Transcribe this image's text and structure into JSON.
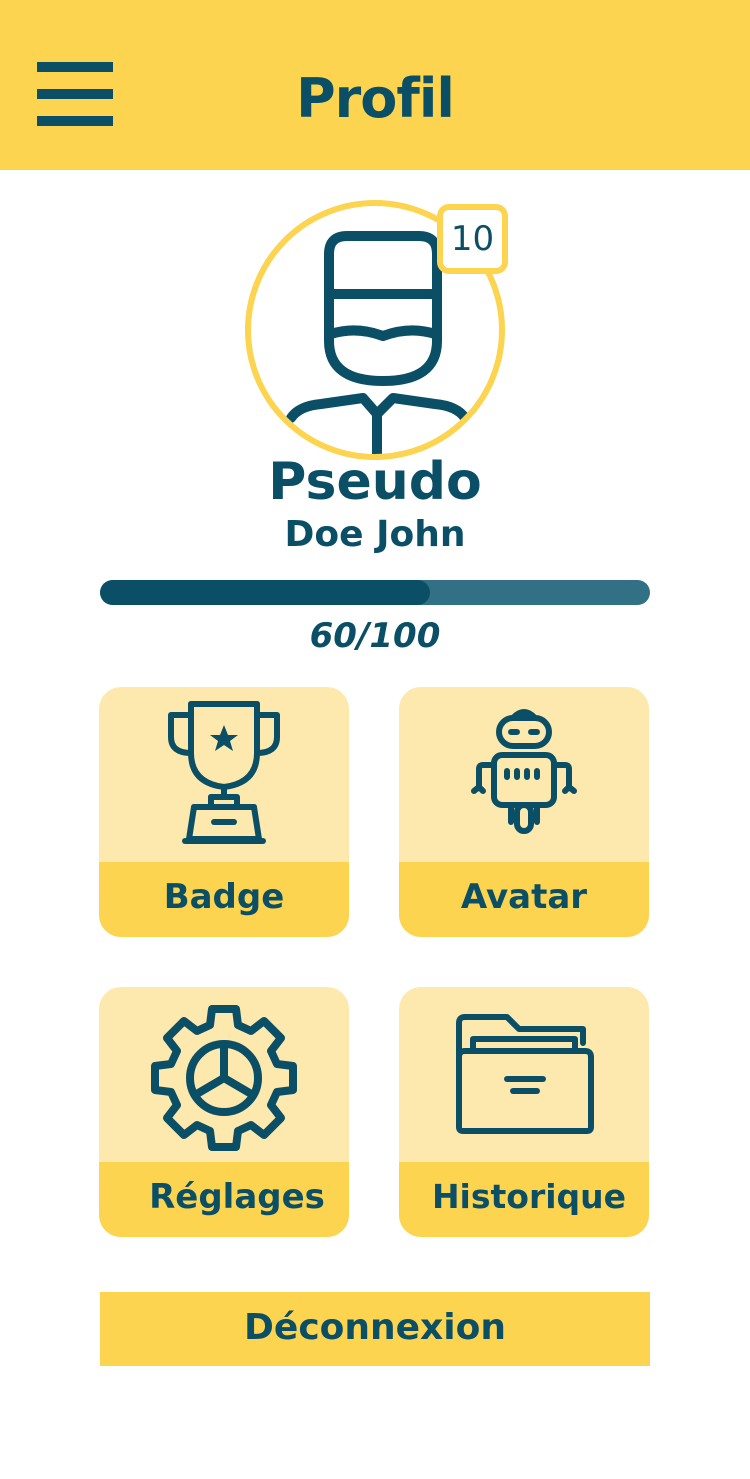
{
  "header": {
    "title": "Profil",
    "menu_icon": "hamburger-menu-icon"
  },
  "profile": {
    "avatar_icon": "masked-person-icon",
    "level": "10",
    "pseudo": "Pseudo",
    "full_name": "Doe John",
    "progress": {
      "value": 60,
      "max": 100,
      "label": "60/100"
    }
  },
  "tiles": [
    {
      "label": "Badge",
      "icon": "trophy-icon"
    },
    {
      "label": "Avatar",
      "icon": "robot-icon"
    },
    {
      "label": "Réglages",
      "icon": "gear-icon"
    },
    {
      "label": "Historique",
      "icon": "folder-icon"
    }
  ],
  "logout": {
    "label": "Déconnexion"
  },
  "colors": {
    "accent": "#fdd44f",
    "accent_light": "#fde9ae",
    "primary": "#0b4f66",
    "progress_track": "#317085"
  }
}
